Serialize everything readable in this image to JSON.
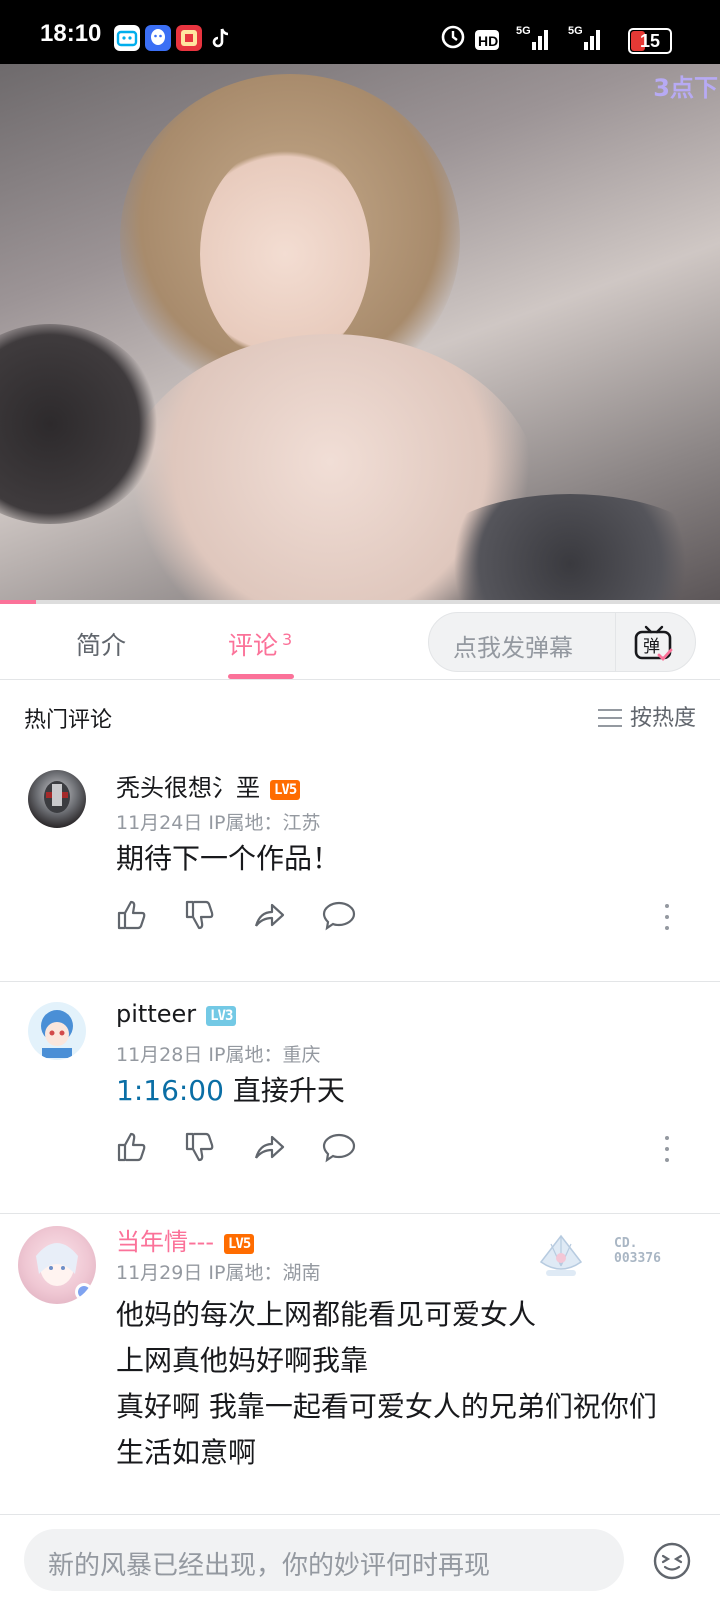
{
  "status_bar": {
    "time": "18:10",
    "network": "5G",
    "battery": "15",
    "icons": [
      "bilibili-app-icon",
      "qq-app-icon",
      "taobao-app-icon",
      "tiktok-app-icon",
      "alarm-icon",
      "hd-icon",
      "signal-icon",
      "signal-icon"
    ]
  },
  "video": {
    "corner_text": "3点下",
    "progress_fraction": 0.05
  },
  "tabs": {
    "intro": "简介",
    "comments": "评论",
    "comments_count": "3",
    "danmaku_placeholder": "点我发弹幕",
    "danmaku_icon_label": "弹"
  },
  "hot": {
    "title": "热门评论",
    "sort": "按热度"
  },
  "comments": [
    {
      "user": "秃头很想氵垩",
      "level": "LV5",
      "date": "11月24日",
      "ip": "IP属地：江苏",
      "text": "期待下一个作品！"
    },
    {
      "user": "pitteer",
      "level": "LV3",
      "date": "11月28日",
      "ip": "IP属地：重庆",
      "timestamp": "1:16:00",
      "text": " 直接升天"
    },
    {
      "user": "当年情---",
      "level": "LV5",
      "date": "11月29日",
      "ip": "IP属地：湖南",
      "badge_no": "CD.",
      "badge_id": "003376",
      "lines": [
        "他妈的每次上网都能看见可爱女人",
        "上网真他妈好啊我靠",
        "真好啊 我靠一起看可爱女人的兄弟们祝你们",
        "生活如意啊"
      ]
    }
  ],
  "bottom": {
    "placeholder": "新的风暴已经出现，你的妙评何时再现"
  },
  "colors": {
    "accent": "#fb7299",
    "lv5": "#ff6c00",
    "lv3": "#73c9e5",
    "timestamp": "#0a6ea5"
  }
}
